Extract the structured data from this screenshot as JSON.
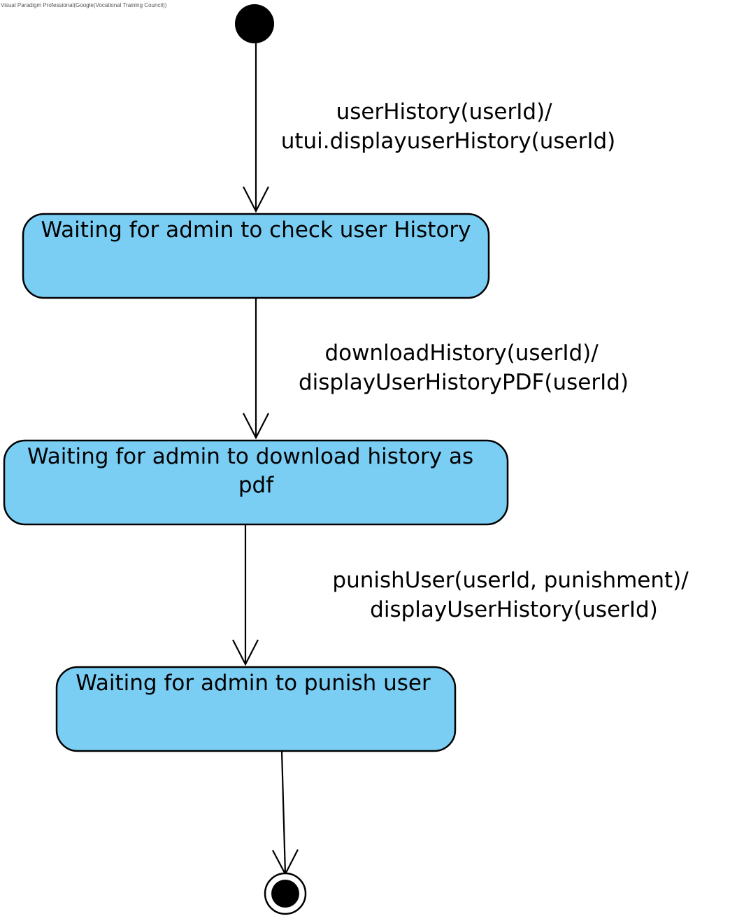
{
  "watermark": "Visual Paradigm Professional(Google(Vocational Training Council))",
  "states": [
    {
      "id": "check-history",
      "lines": [
        "Waiting for admin to check user History"
      ]
    },
    {
      "id": "download-history",
      "lines": [
        "Waiting for admin to download history as",
        "pdf"
      ]
    },
    {
      "id": "punish-user",
      "lines": [
        "Waiting for admin to punish user"
      ]
    }
  ],
  "transitions": [
    {
      "id": "user-history",
      "lines": [
        "userHistory(userId)/",
        "utui.displayuserHistory(userId)"
      ]
    },
    {
      "id": "download-history",
      "lines": [
        "downloadHistory(userId)/",
        "displayUserHistoryPDF(userId)"
      ]
    },
    {
      "id": "punish-user",
      "lines": [
        "punishUser(userId, punishment)/",
        "displayUserHistory(userId)"
      ]
    }
  ],
  "colors": {
    "state_fill": "#7acef4",
    "stroke": "#000000"
  }
}
